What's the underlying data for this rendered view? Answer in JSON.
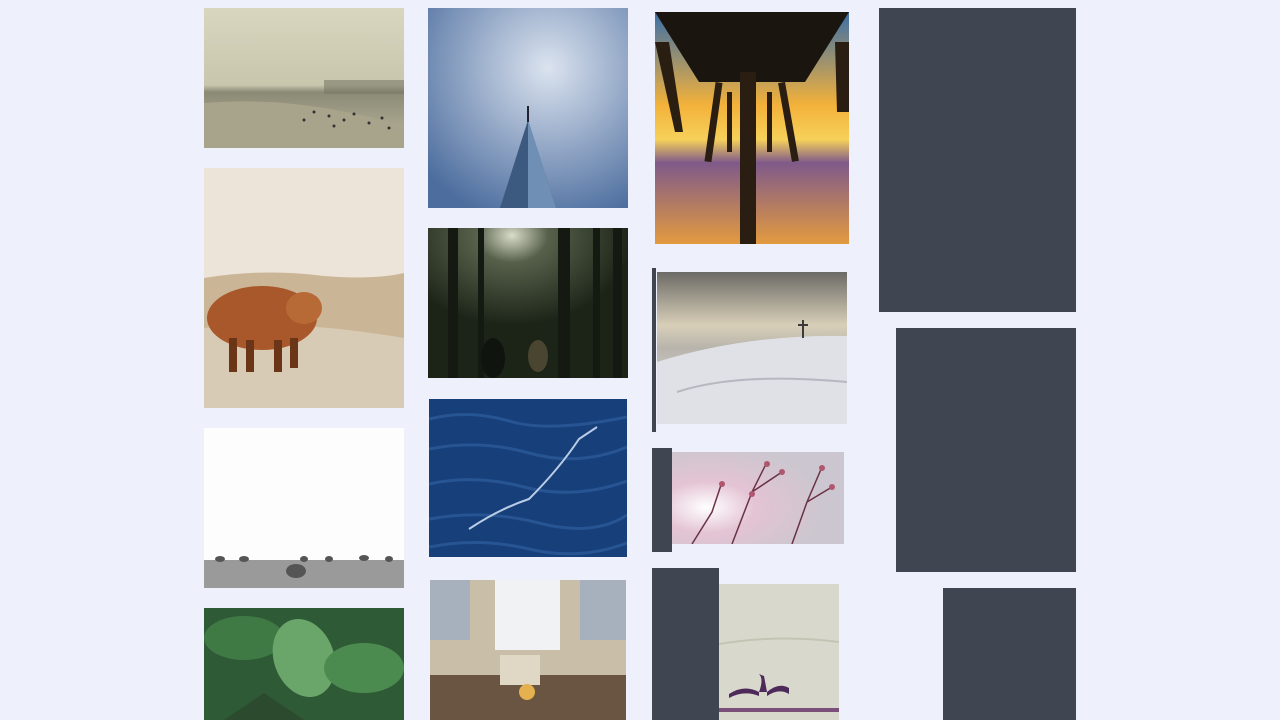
{
  "gallery": {
    "layout": "masonry",
    "placeholder_color": "#404651",
    "background_color": "#eef0fb",
    "photos": [
      {
        "subject": "beach-crowd"
      },
      {
        "subject": "skyscraper"
      },
      {
        "subject": "pier-sunset"
      },
      {
        "subject": "highland-cow"
      },
      {
        "subject": "forest-light"
      },
      {
        "subject": "snowy-hill-cross"
      },
      {
        "subject": "hay-bales-field"
      },
      {
        "subject": "ocean-water"
      },
      {
        "subject": "blossom-branches"
      },
      {
        "subject": "green-leaves"
      },
      {
        "subject": "grand-central-hall"
      },
      {
        "subject": "cormorant-wings"
      }
    ]
  }
}
